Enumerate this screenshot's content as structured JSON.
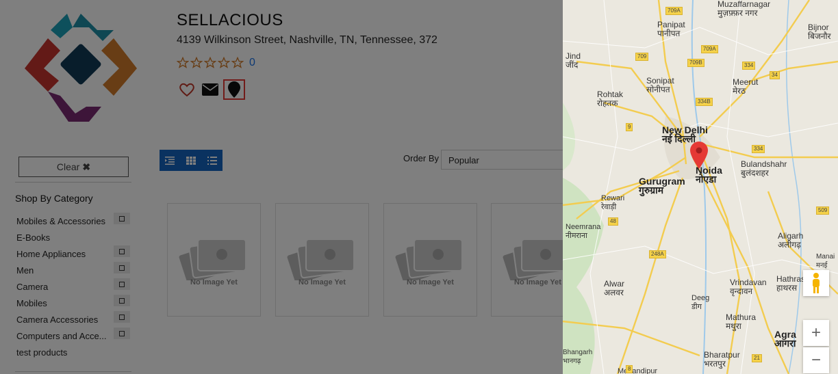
{
  "store": {
    "name": "SELLACIOUS",
    "address": "4139 Wilkinson Street, Nashville, TN, Tennessee, 372",
    "rating_count": "0"
  },
  "icons": {
    "favorite": "heart-icon",
    "email": "envelope-icon",
    "location": "map-marker-icon"
  },
  "toolbar": {
    "order_by_label": "Order By",
    "order_by_value": "Popular"
  },
  "filter": {
    "clear_label": "Clear",
    "category_title": "Shop By Category",
    "categories": [
      {
        "label": "Mobiles & Accessories",
        "expandable": true
      },
      {
        "label": "E-Books",
        "expandable": false
      },
      {
        "label": "Home Appliances",
        "expandable": true
      },
      {
        "label": "Men",
        "expandable": true
      },
      {
        "label": "Camera",
        "expandable": true
      },
      {
        "label": "Mobiles",
        "expandable": true
      },
      {
        "label": "Camera Accessories",
        "expandable": true
      },
      {
        "label": "Computers and Acce...",
        "expandable": true
      },
      {
        "label": "test products",
        "expandable": false
      }
    ]
  },
  "products": [
    {
      "placeholder": "No Image Yet"
    },
    {
      "placeholder": "No Image Yet"
    },
    {
      "placeholder": "No Image Yet"
    },
    {
      "placeholder": "No Image Yet"
    }
  ],
  "map": {
    "cities": [
      {
        "name": "Muzaffarnagar",
        "local": "मुज़फ़्फ़र नगर"
      },
      {
        "name": "Panipat",
        "local": "पानीपत"
      },
      {
        "name": "Bijnor",
        "local": "बिजनौर"
      },
      {
        "name": "Jind",
        "local": "जींद"
      },
      {
        "name": "Sonipat",
        "local": "सोनीपत"
      },
      {
        "name": "Meerut",
        "local": "मेरठ"
      },
      {
        "name": "Rohtak",
        "local": "रोहतक"
      },
      {
        "name": "New Delhi",
        "local": "नई दिल्ली"
      },
      {
        "name": "Noida",
        "local": "नोएडा"
      },
      {
        "name": "Bulandshahr",
        "local": "बुलंदशहर"
      },
      {
        "name": "Gurugram",
        "local": "गुरुग्राम"
      },
      {
        "name": "Rewari",
        "local": "रेवाड़ी"
      },
      {
        "name": "Neemrana",
        "local": "नीमराना"
      },
      {
        "name": "Aligarh",
        "local": "अलीगढ़"
      },
      {
        "name": "Manai",
        "local": "मनई"
      },
      {
        "name": "Alwar",
        "local": "अलवर"
      },
      {
        "name": "Vrindavan",
        "local": "वृन्दावन"
      },
      {
        "name": "Hathras",
        "local": "हाथरस"
      },
      {
        "name": "Deeg",
        "local": "डीग"
      },
      {
        "name": "Mathura",
        "local": "मथुरा"
      },
      {
        "name": "Agra",
        "local": "आगरा"
      },
      {
        "name": "Bhangarh",
        "local": "भानगढ़"
      },
      {
        "name": "Bharatpur",
        "local": "भरतपुर"
      },
      {
        "name": "Mehandipur",
        "local": ""
      }
    ],
    "highways": [
      "709A",
      "709A",
      "709",
      "709B",
      "334",
      "34",
      "334B",
      "9",
      "334",
      "48",
      "248A",
      "509",
      "21",
      "8"
    ],
    "zoom_in": "+",
    "zoom_out": "−"
  }
}
